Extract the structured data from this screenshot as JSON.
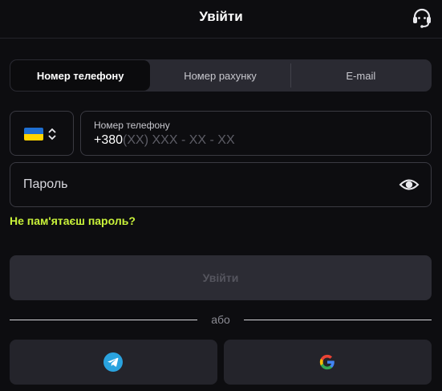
{
  "header": {
    "title": "Увійти",
    "support_icon": "headset-icon"
  },
  "tabs": [
    {
      "label": "Номер телефону",
      "active": true
    },
    {
      "label": "Номер рахунку",
      "active": false
    },
    {
      "label": "E-mail",
      "active": false
    }
  ],
  "country": {
    "flag": "ukraine-flag",
    "colors": [
      "#1f6fd1",
      "#ffd500"
    ]
  },
  "phone": {
    "label": "Номер телефону",
    "prefix": "+380",
    "mask": "(XX) XXX - XX - XX"
  },
  "password": {
    "label": "Пароль",
    "icon": "eye-icon"
  },
  "forgot_password": "Не пам'ятаєш пароль?",
  "login_button": "Увійти",
  "divider": "або",
  "social": [
    {
      "name": "telegram",
      "icon": "telegram-icon"
    },
    {
      "name": "google",
      "icon": "google-icon"
    }
  ],
  "colors": {
    "background": "#0d0d10",
    "accent": "#c9f23a",
    "telegram": "#2aa3df"
  }
}
